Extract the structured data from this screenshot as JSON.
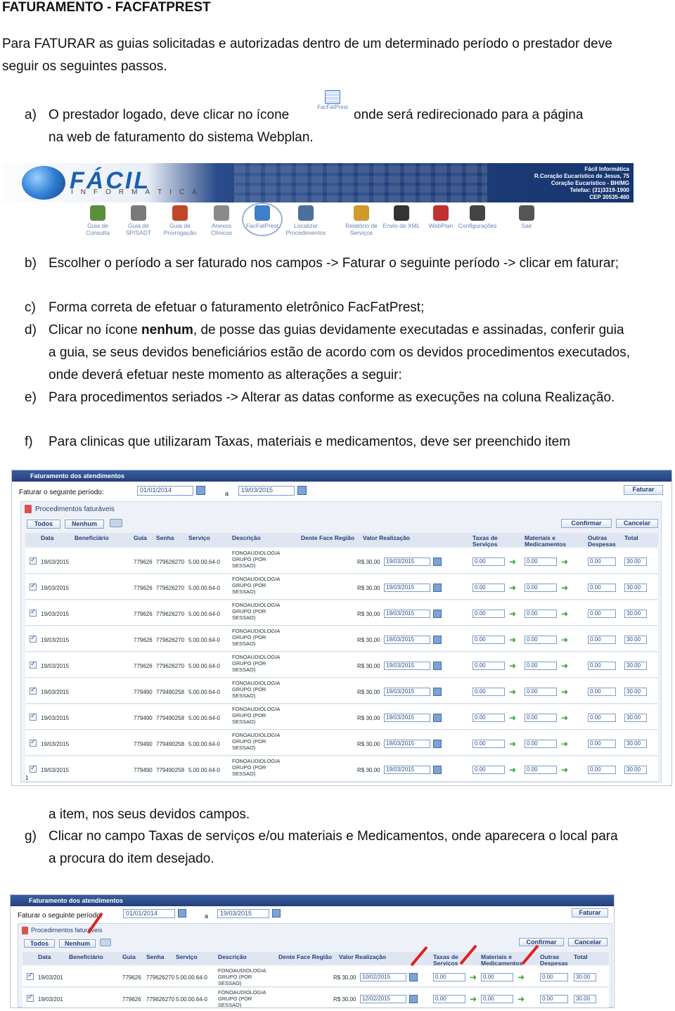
{
  "doc": {
    "title": "FATURAMENTO - FACFATPREST",
    "intro": "Para FATURAR as guias solicitadas e autorizadas dentro de um determinado período o prestador deve seguir os seguintes passos.",
    "step_a": {
      "marker": "a)",
      "text1": "O prestador logado, deve clicar no ícone",
      "icon_label": "FacFatPrest",
      "text2": "onde será redirecionado para a página",
      "text3": "na web de faturamento do sistema Webplan."
    },
    "step_b": {
      "marker": "b)",
      "text": "Escolher o período a ser faturado nos campos -> Faturar o seguinte período -> clicar em faturar;"
    },
    "step_c": {
      "marker": "c)",
      "text": "Forma correta de efetuar o faturamento eletrônico FacFatPrest;"
    },
    "step_d": {
      "marker": "d)",
      "text_pre": "Clicar no ícone ",
      "bold": "nenhum",
      "text_post": ", de posse das guias devidamente executadas e assinadas, conferir guia a guia, se seus devidos beneficiários estão de acordo com os devidos procedimentos executados, onde deverá efetuar neste momento as alterações a seguir:"
    },
    "step_e": {
      "marker": "e)",
      "text": "Para procedimentos seriados -> Alterar as datas conforme as execuções na coluna Realização."
    },
    "step_f": {
      "marker": "f)",
      "text": "Para clinicas que utilizaram Taxas, materiais e medicamentos, deve ser preenchido item"
    },
    "step_f2": {
      "text": "a item, nos seus devidos campos."
    },
    "step_g": {
      "marker": "g)",
      "text": "Clicar no campo Taxas de serviços e/ou materiais e Medicamentos, onde aparecera o local para a procura do item desejado."
    }
  },
  "banner": {
    "logo": "FÁCIL",
    "sub": "INFORMÁTICA",
    "info": [
      "Fácil Informática",
      "R.Coração Eucarístico de Jesus, 75",
      "Coração Eucarístico - BH/MG",
      "Telefax: (31)3319-1900",
      "CEP 30535-460"
    ]
  },
  "toolbar": [
    {
      "label": "Guia de Consulta",
      "icon": "consulta-icon",
      "color": "#5a8f3d"
    },
    {
      "label": "Guia de SP/SADT",
      "icon": "sadt-icon",
      "color": "#7a7a7a"
    },
    {
      "label": "Guia de Prorrogação",
      "icon": "prorrogacao-icon",
      "color": "#c0462a"
    },
    {
      "label": "Anexos Clínicos",
      "icon": "anexos-icon",
      "color": "#8a8a8a"
    },
    {
      "label": "FacFatPrest",
      "icon": "facfatprest-icon",
      "color": "#3f7fc7"
    },
    {
      "label": "Localizar Procedimentos",
      "icon": "localizar-icon",
      "color": "#4d6f9c"
    },
    {
      "label": "Relatório de Serviços",
      "icon": "relatorio-icon",
      "color": "#d39a2b"
    },
    {
      "label": "Envio de XML",
      "icon": "envio-xml-icon",
      "color": "#333333"
    },
    {
      "label": "WebPlan",
      "icon": "webplan-icon",
      "color": "#c23030"
    },
    {
      "label": "Configurações",
      "icon": "gear-icon",
      "color": "#444444"
    },
    {
      "label": "Sair",
      "icon": "exit-icon",
      "color": "#555555"
    }
  ],
  "screen1": {
    "header": "Faturamento dos atendimentos",
    "period_label": "Faturar o seguinte período:",
    "date_from": "01/01/2014",
    "sep": "a",
    "date_to": "19/03/2015",
    "faturar": "Faturar",
    "panel_title": "Procedimentos faturáveis",
    "todos": "Todos",
    "nenhum": "Nenhum",
    "confirmar": "Confirmar",
    "cancelar": "Cancelar",
    "columns": [
      "Data",
      "Beneficiário",
      "Guia",
      "Senha",
      "Serviço",
      "Descrição",
      "Dente Face Região",
      "Valor Realização",
      "Taxas de Serviços",
      "Materiais e Medicamentos",
      "Outras Despesas",
      "Total"
    ],
    "rows": [
      {
        "data": "19/03/2015",
        "guia": "779626",
        "senha": "779626270",
        "servico": "5.00.00.64-0",
        "desc": "FONOAUDIOLOGIA GRUPO (POR SESSAO)",
        "valor": "R$ 30,00",
        "realiz": "19/03/2015",
        "taxas": "0.00",
        "mat": "0.00",
        "outras": "0.00",
        "total": "30.00"
      },
      {
        "data": "19/03/2015",
        "guia": "779626",
        "senha": "779626270",
        "servico": "5.00.00.64-0",
        "desc": "FONOAUDIOLOGIA GRUPO (POR SESSAO)",
        "valor": "R$ 30,00",
        "realiz": "19/03/2015",
        "taxas": "0.00",
        "mat": "0.00",
        "outras": "0.00",
        "total": "30.00"
      },
      {
        "data": "19/03/2015",
        "guia": "779626",
        "senha": "779626270",
        "servico": "5.00.00.64-0",
        "desc": "FONOAUDIOLOGIA GRUPO (POR SESSAO)",
        "valor": "R$ 30,00",
        "realiz": "19/03/2015",
        "taxas": "0.00",
        "mat": "0.00",
        "outras": "0.00",
        "total": "30.00"
      },
      {
        "data": "19/03/2015",
        "guia": "779626",
        "senha": "779626270",
        "servico": "5.00.00.64-0",
        "desc": "FONOAUDIOLOGIA GRUPO (POR SESSAO)",
        "valor": "R$ 30,00",
        "realiz": "19/03/2015",
        "taxas": "0.00",
        "mat": "0.00",
        "outras": "0.00",
        "total": "30.00"
      },
      {
        "data": "19/03/2015",
        "guia": "779626",
        "senha": "779626270",
        "servico": "5.00.00.64-0",
        "desc": "FONOAUDIOLOGIA GRUPO (POR SESSAO)",
        "valor": "R$ 30,00",
        "realiz": "19/03/2015",
        "taxas": "0.00",
        "mat": "0.00",
        "outras": "0.00",
        "total": "30.00"
      },
      {
        "data": "19/03/2015",
        "guia": "779490",
        "senha": "779490258",
        "servico": "5.00.00.64-0",
        "desc": "FONOAUDIOLOGIA GRUPO (POR SESSAO)",
        "valor": "R$ 30,00",
        "realiz": "19/03/2015",
        "taxas": "0.00",
        "mat": "0.00",
        "outras": "0.00",
        "total": "30.00"
      },
      {
        "data": "19/03/2015",
        "guia": "779490",
        "senha": "779490258",
        "servico": "5.00.00.64-0",
        "desc": "FONOAUDIOLOGIA GRUPO (POR SESSAO)",
        "valor": "R$ 30,00",
        "realiz": "19/03/2015",
        "taxas": "0.00",
        "mat": "0.00",
        "outras": "0.00",
        "total": "30.00"
      },
      {
        "data": "19/03/2015",
        "guia": "779490",
        "senha": "779490258",
        "servico": "5.00.00.64-0",
        "desc": "FONOAUDIOLOGIA GRUPO (POR SESSAO)",
        "valor": "R$ 30,00",
        "realiz": "19/03/2015",
        "taxas": "0.00",
        "mat": "0.00",
        "outras": "0.00",
        "total": "30.00"
      },
      {
        "data": "19/03/2015",
        "guia": "779490",
        "senha": "779490258",
        "servico": "5.00.00.64-0",
        "desc": "FONOAUDIOLOGIA GRUPO (POR SESSAO)",
        "valor": "R$ 30,00",
        "realiz": "19/03/2015",
        "taxas": "0.00",
        "mat": "0.00",
        "outras": "0.00",
        "total": "30.00"
      }
    ],
    "page": "1"
  },
  "screen2": {
    "header": "Faturamento dos atendimentos",
    "period_label": "Faturar o seguinte período:",
    "date_from": "01/01/2014",
    "sep": "a",
    "date_to": "19/03/2015",
    "faturar": "Faturar",
    "panel_title": "Procedimentos faturáveis",
    "todos": "Todos",
    "nenhum": "Nenhum",
    "confirmar": "Confirmar",
    "cancelar": "Cancelar",
    "columns": [
      "Data",
      "Beneficiário",
      "Guia",
      "Senha",
      "Serviço",
      "Descrição",
      "Dente Face Região",
      "Valor Realização",
      "Taxas de Serviços",
      "Materiais e Medicamentos",
      "Outras Despesas",
      "Total"
    ],
    "rows": [
      {
        "data": "19/03/201",
        "guia": "779626",
        "senha": "779626270",
        "servico": "5.00.00.64-0",
        "desc": "FONOAUDIOLOGIA GRUPO (POR SESSAO)",
        "valor": "R$ 30,00",
        "realiz": "10/02/2015",
        "taxas": "0.00",
        "mat": "0.00",
        "outras": "0.00",
        "total": "30.00"
      },
      {
        "data": "19/03/201",
        "guia": "779626",
        "senha": "779626270",
        "servico": "5.00.00.64-0",
        "desc": "FONOAUDIOLOGIA GRUPO (POR SESSAO)",
        "valor": "R$ 30,00",
        "realiz": "12/02/2015",
        "taxas": "0.00",
        "mat": "0.00",
        "outras": "0.00",
        "total": "30.00"
      }
    ]
  }
}
